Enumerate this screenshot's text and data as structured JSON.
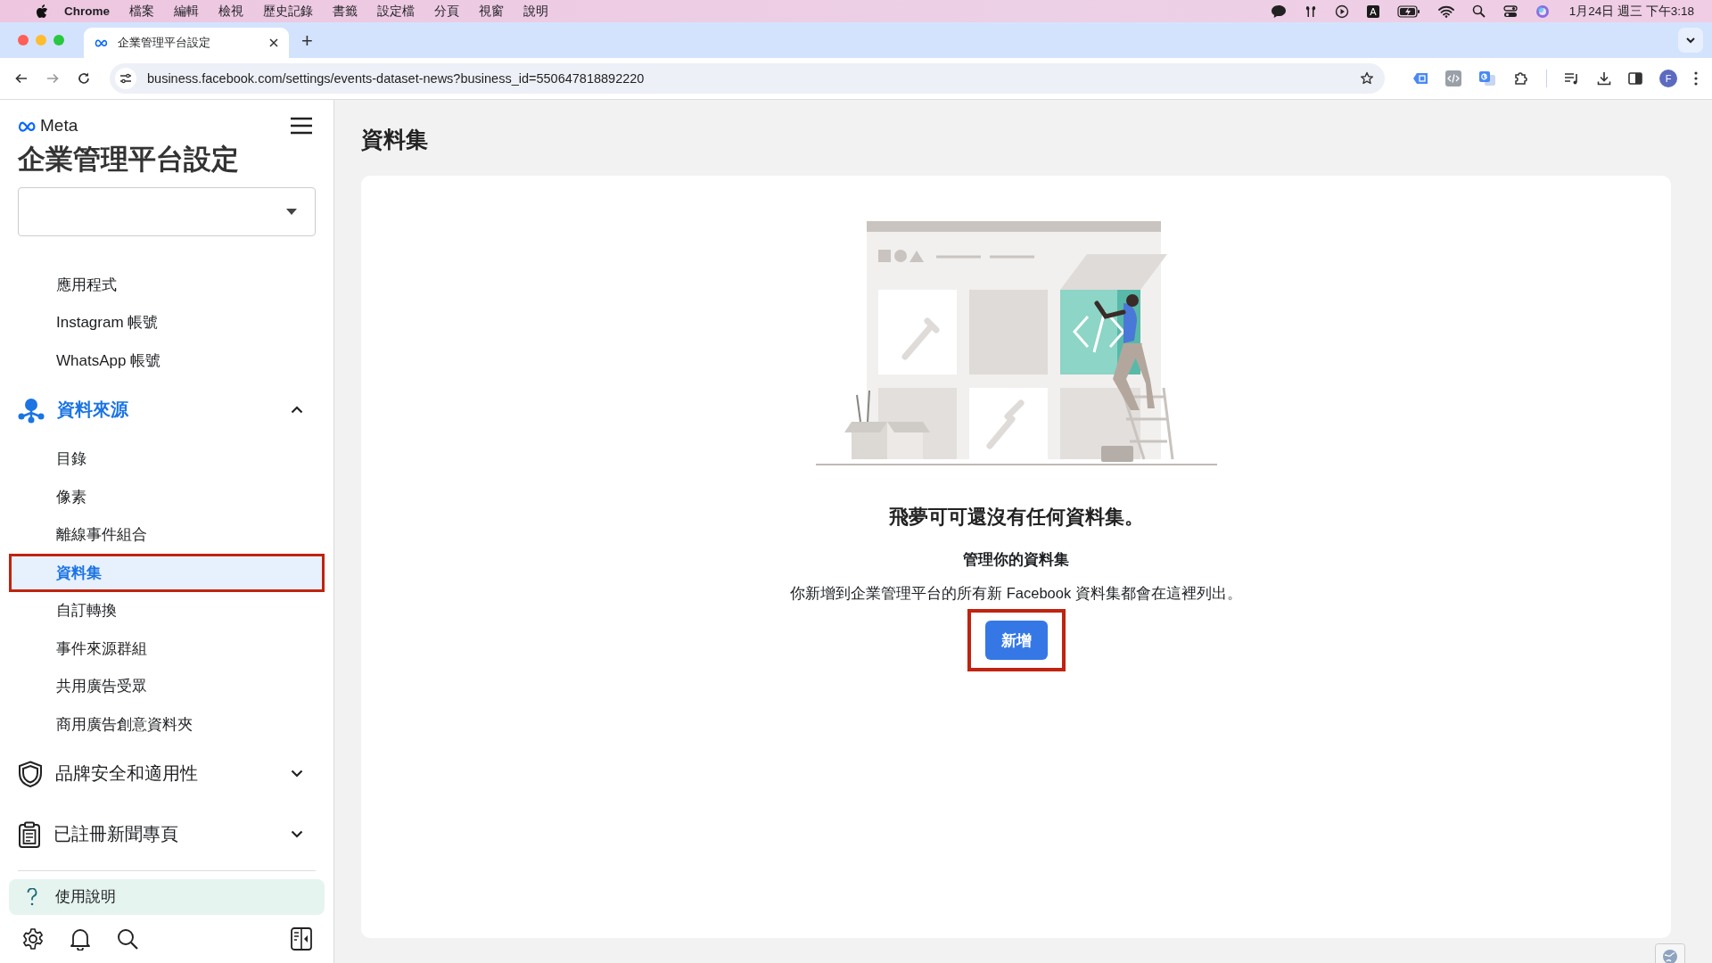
{
  "menu_bar": {
    "app": "Chrome",
    "menus": [
      "檔案",
      "編輯",
      "檢視",
      "歷史記錄",
      "書籤",
      "設定檔",
      "分頁",
      "視窗",
      "說明"
    ],
    "input_method": "A",
    "clock": "1月24日 週三 下午3:18"
  },
  "browser": {
    "tab": {
      "title": "企業管理平台設定",
      "selected": true
    },
    "new_tab": "+",
    "url": "business.facebook.com/settings/events-dataset-news?business_id=550647818892220",
    "profile": "F"
  },
  "sidebar": {
    "brand": "Meta",
    "title": "企業管理平台設定",
    "items": [
      {
        "label": "應用程式",
        "selected": false
      },
      {
        "label": "Instagram 帳號",
        "selected": false
      },
      {
        "label": "WhatsApp 帳號",
        "selected": false
      }
    ],
    "sections": [
      {
        "label": "資料來源",
        "expanded": true,
        "children": [
          {
            "label": "目錄",
            "selected": false,
            "highlighted": false
          },
          {
            "label": "像素",
            "selected": false,
            "highlighted": false
          },
          {
            "label": "離線事件組合",
            "selected": false,
            "highlighted": false
          },
          {
            "label": "資料集",
            "selected": true,
            "highlighted": true
          },
          {
            "label": "自訂轉換",
            "selected": false,
            "highlighted": false
          },
          {
            "label": "事件來源群組",
            "selected": false,
            "highlighted": false
          },
          {
            "label": "共用廣告受眾",
            "selected": false,
            "highlighted": false
          },
          {
            "label": "商用廣告創意資料夾",
            "selected": false,
            "highlighted": false
          }
        ]
      },
      {
        "label": "品牌安全和適用性",
        "expanded": false
      },
      {
        "label": "已註冊新聞專頁",
        "expanded": false
      }
    ],
    "help": "使用說明"
  },
  "main": {
    "title": "資料集",
    "empty_state": {
      "title": "飛夢可可還沒有任何資料集。",
      "subtitle": "管理你的資料集",
      "description": "你新增到企業管理平台的所有新 Facebook 資料集都會在這裡列出。",
      "button": {
        "label": "新增",
        "highlighted": true
      }
    }
  }
}
